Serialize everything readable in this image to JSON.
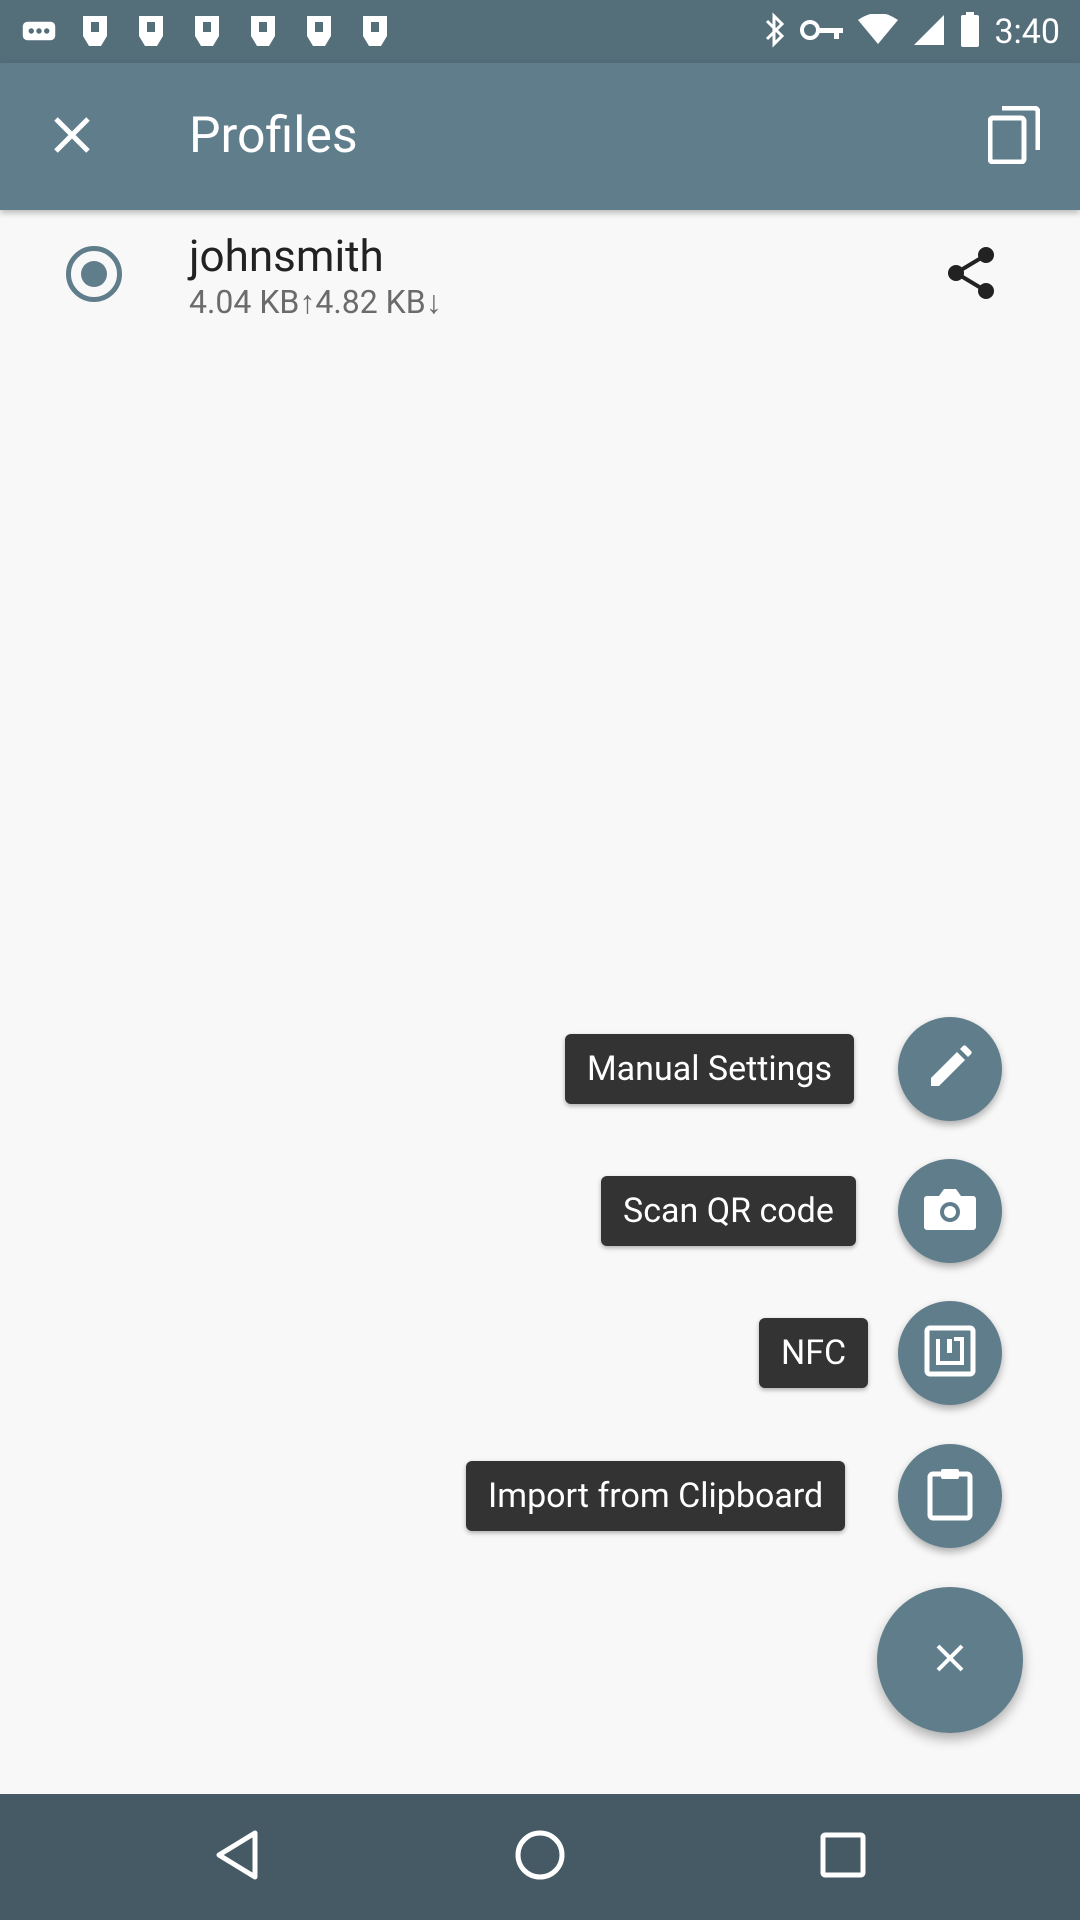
{
  "status_bar": {
    "time": "3:40",
    "left_icons": [
      "more-icon",
      "notification-icon",
      "notification-icon",
      "notification-icon",
      "notification-icon",
      "notification-icon",
      "notification-icon"
    ],
    "right_icons": [
      "bluetooth-icon",
      "vpn-key-icon",
      "wifi-icon",
      "signal-icon",
      "battery-icon"
    ]
  },
  "toolbar": {
    "title": "Profiles"
  },
  "profile": {
    "name": "johnsmith",
    "stats": "4.04 KB↑4.82 KB↓",
    "selected": true
  },
  "fab_menu": {
    "items": [
      {
        "label": "Manual Settings",
        "icon": "pencil-icon"
      },
      {
        "label": "Scan QR code",
        "icon": "camera-icon"
      },
      {
        "label": "NFC",
        "icon": "nfc-icon"
      },
      {
        "label": "Import from Clipboard",
        "icon": "clipboard-icon"
      }
    ],
    "main_icon": "close-icon"
  },
  "colors": {
    "primary": "#607d8b",
    "primary_dark": "#546e7a",
    "nav_bar": "#455a64",
    "label_bg": "#333333"
  }
}
